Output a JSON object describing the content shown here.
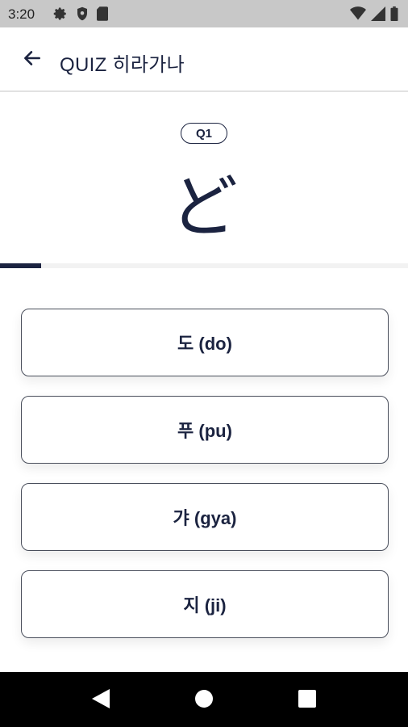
{
  "status_bar": {
    "time": "3:20",
    "icons_left": [
      "gear-icon",
      "shield-icon",
      "sd-card-icon"
    ],
    "icons_right": [
      "wifi-icon",
      "signal-icon",
      "battery-icon"
    ]
  },
  "app_bar": {
    "back_icon": "arrow-left-icon",
    "title": "QUIZ 히라가나"
  },
  "question": {
    "badge": "Q1",
    "character": "ど"
  },
  "progress": {
    "value": 0.1,
    "fill_color": "#1b2340",
    "track_color": "#f2f2f2"
  },
  "answers": [
    {
      "label": "도 (do)"
    },
    {
      "label": "푸 (pu)"
    },
    {
      "label": "갸 (gya)"
    },
    {
      "label": "지 (ji)"
    }
  ],
  "nav_bar": {
    "icons": [
      "back-triangle-icon",
      "home-circle-icon",
      "recents-square-icon"
    ]
  },
  "colors": {
    "primary": "#1b2340",
    "status_bar": "#c8c8c8",
    "nav_bar": "#000000"
  }
}
